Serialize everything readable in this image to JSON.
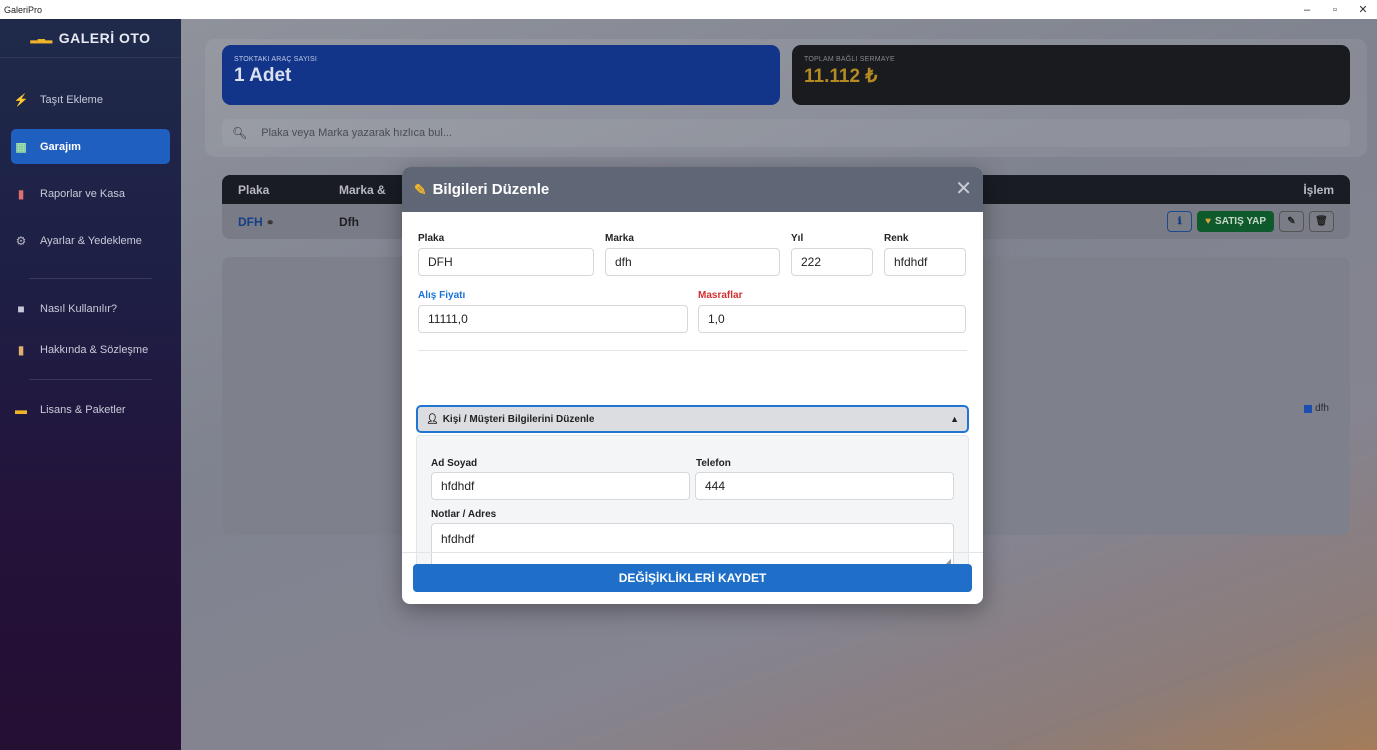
{
  "window": {
    "title": "GaleriPro",
    "minimize": "–",
    "restore": "▫",
    "close": "✕"
  },
  "sidebar": {
    "brand": "GALERİ OTO",
    "items": [
      {
        "label": "Taşıt Ekleme",
        "icon": "⚡"
      },
      {
        "label": "Garajım",
        "icon": "▦",
        "active": true
      },
      {
        "label": "Raporlar ve Kasa",
        "icon": "▮"
      },
      {
        "label": "Ayarlar & Yedekleme",
        "icon": "⚙"
      }
    ],
    "items2": [
      {
        "label": "Nasıl Kullanılır?",
        "icon": "■"
      },
      {
        "label": "Hakkında & Sözleşme",
        "icon": "▮"
      }
    ],
    "items3": [
      {
        "label": "Lisans & Paketler",
        "icon": "▬"
      }
    ]
  },
  "stats": {
    "stock_label": "STOKTAKI ARAÇ SAYISI",
    "stock_value": "1 Adet",
    "capital_label": "TOPLAM BAĞLI SERMAYE",
    "capital_value": "11.112 ₺"
  },
  "search": {
    "placeholder": "Plaka veya Marka yazarak hızlıca bul..."
  },
  "table": {
    "headers": {
      "plate": "Plaka",
      "brand": "Marka &",
      "action": "İşlem"
    },
    "row": {
      "plate": "DFH",
      "brand": "Dfh",
      "sell": "SATIŞ YAP"
    }
  },
  "chart": {
    "legend": "dfh",
    "legend_color": "#1e4db0"
  },
  "modal": {
    "title": "Bilgileri Düzenle",
    "close": "✕",
    "labels": {
      "plate": "Plaka",
      "brand": "Marka",
      "year": "Yıl",
      "color": "Renk",
      "purchase": "Alış Fiyatı",
      "expenses": "Masraflar"
    },
    "values": {
      "plate": "DFH",
      "brand": "dfh",
      "year": "222",
      "color": "hfdhdf",
      "purchase": "11111,0",
      "expenses": "1,0"
    },
    "person_section": {
      "title": "Kişi / Müşteri Bilgilerini Düzenle",
      "arrow": "▲",
      "name_label": "Ad Soyad",
      "phone_label": "Telefon",
      "notes_label": "Notlar / Adres",
      "name": "hfdhdf",
      "phone": "444",
      "notes": "hfdhdf"
    },
    "save": "DEĞİŞİKLİKLERİ KAYDET"
  }
}
